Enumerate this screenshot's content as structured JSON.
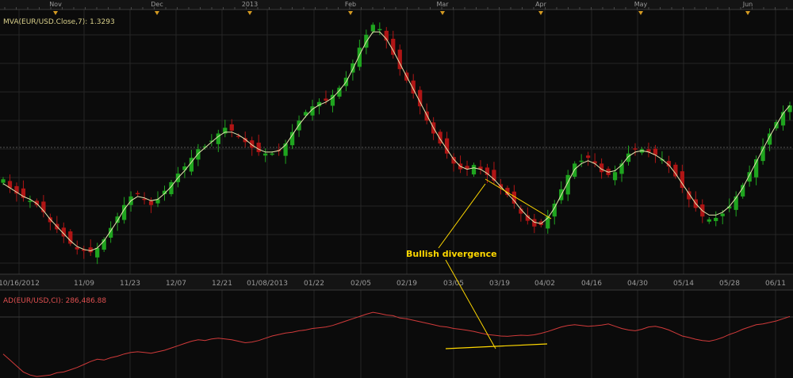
{
  "colors": {
    "background": "#0b0b0b",
    "grid": "#262626",
    "axis_text": "#9a9a9a",
    "bull": "#1fa51f",
    "bear": "#b01515",
    "mva": "#e6e6b0",
    "ad_line": "#d03a3a",
    "annotation": "#ffd800",
    "mva_label": "#d8cf8a",
    "ad_label": "#e05050",
    "event_marker": "#d49a22"
  },
  "top_axis": {
    "months": [
      "Nov",
      "Dec",
      "2013",
      "Feb",
      "Mar",
      "Apr",
      "May",
      "Jun"
    ]
  },
  "bottom_axis": {
    "labels": [
      "10/16/2012",
      "11/09",
      "11/23",
      "12/07",
      "12/21",
      "01/08/2013",
      "01/22",
      "02/05",
      "02/19",
      "03/05",
      "03/19",
      "04/02",
      "04/16",
      "04/30",
      "05/14",
      "05/28",
      "06/11"
    ]
  },
  "price_panel": {
    "indicator_label": "MVA(EUR/USD.Close,7): 1.3293"
  },
  "ad_panel": {
    "indicator_label": "AD(EUR/USD,CI): 286,486.88"
  },
  "annotation": {
    "text": "Bullish divergence"
  },
  "chart_data": [
    {
      "type": "candlestick",
      "series": [
        {
          "name": "EUR/USD",
          "close": [
            1.3035,
            1.3005,
            1.2985,
            1.297,
            1.296,
            1.2945,
            1.292,
            1.2885,
            1.286,
            1.2835,
            1.281,
            1.279,
            1.2785,
            1.278,
            1.2795,
            1.2825,
            1.2865,
            1.2905,
            1.2945,
            1.2975,
            1.2985,
            1.2965,
            1.2945,
            1.2965,
            1.2995,
            1.3025,
            1.3055,
            1.308,
            1.311,
            1.314,
            1.315,
            1.317,
            1.3195,
            1.3215,
            1.3205,
            1.3185,
            1.3165,
            1.3145,
            1.313,
            1.3125,
            1.3125,
            1.3135,
            1.316,
            1.32,
            1.324,
            1.327,
            1.329,
            1.3305,
            1.331,
            1.333,
            1.3355,
            1.339,
            1.344,
            1.3495,
            1.354,
            1.3575,
            1.356,
            1.352,
            1.347,
            1.342,
            1.338,
            1.3335,
            1.329,
            1.324,
            1.3195,
            1.316,
            1.3125,
            1.309,
            1.307,
            1.307,
            1.3085,
            1.307,
            1.305,
            1.303,
            1.3005,
            1.298,
            1.295,
            1.2915,
            1.289,
            1.287,
            1.2875,
            1.2905,
            1.295,
            1.3,
            1.305,
            1.309,
            1.31,
            1.311,
            1.309,
            1.306,
            1.305,
            1.306,
            1.309,
            1.3125,
            1.314,
            1.314,
            1.313,
            1.312,
            1.3105,
            1.308,
            1.3045,
            1.3005,
            1.2965,
            1.2935,
            1.2905,
            1.2895,
            1.29,
            1.2915,
            1.294,
            1.2975,
            1.3015,
            1.306,
            1.3105,
            1.315,
            1.3195,
            1.3235,
            1.327,
            1.3293
          ]
        },
        {
          "name": "MVA(EUR/USD.Close,7)",
          "values": [
            1.302,
            1.3005,
            1.299,
            1.2975,
            1.2965,
            1.295,
            1.2925,
            1.2895,
            1.287,
            1.2845,
            1.282,
            1.28,
            1.279,
            1.2785,
            1.2795,
            1.282,
            1.2855,
            1.289,
            1.293,
            1.296,
            1.2975,
            1.297,
            1.296,
            1.2965,
            1.2985,
            1.301,
            1.304,
            1.3065,
            1.3095,
            1.3125,
            1.3145,
            1.3165,
            1.3185,
            1.32,
            1.32,
            1.319,
            1.3175,
            1.3155,
            1.314,
            1.313,
            1.313,
            1.3135,
            1.3155,
            1.319,
            1.3225,
            1.3255,
            1.328,
            1.3295,
            1.3305,
            1.332,
            1.3345,
            1.3375,
            1.342,
            1.347,
            1.3515,
            1.355,
            1.355,
            1.3525,
            1.3485,
            1.344,
            1.3395,
            1.335,
            1.3305,
            1.326,
            1.3215,
            1.3175,
            1.314,
            1.3105,
            1.308,
            1.307,
            1.3075,
            1.307,
            1.3055,
            1.3035,
            1.301,
            1.2985,
            1.296,
            1.293,
            1.2905,
            1.2885,
            1.288,
            1.29,
            1.2935,
            1.298,
            1.3025,
            1.307,
            1.309,
            1.31,
            1.309,
            1.307,
            1.306,
            1.3065,
            1.3085,
            1.3115,
            1.313,
            1.3135,
            1.313,
            1.312,
            1.3105,
            1.3085,
            1.3055,
            1.302,
            1.2985,
            1.295,
            1.2925,
            1.291,
            1.291,
            1.292,
            1.294,
            1.297,
            1.3005,
            1.305,
            1.3095,
            1.314,
            1.3185,
            1.3225,
            1.3265,
            1.3293
          ]
        }
      ],
      "ylim": [
        1.272,
        1.362
      ]
    },
    {
      "type": "line",
      "series": [
        {
          "name": "AD(EUR/USD,CI)",
          "values": [
            160,
            120,
            80,
            40,
            20,
            10,
            15,
            20,
            35,
            40,
            55,
            70,
            90,
            110,
            125,
            120,
            135,
            145,
            160,
            170,
            175,
            170,
            165,
            175,
            185,
            200,
            215,
            230,
            245,
            255,
            250,
            260,
            265,
            260,
            255,
            245,
            235,
            240,
            250,
            265,
            280,
            290,
            300,
            305,
            315,
            320,
            330,
            335,
            340,
            350,
            365,
            380,
            395,
            410,
            425,
            438,
            430,
            420,
            415,
            400,
            395,
            385,
            375,
            365,
            355,
            345,
            340,
            330,
            325,
            318,
            310,
            300,
            290,
            285,
            280,
            278,
            282,
            285,
            283,
            288,
            298,
            310,
            325,
            340,
            350,
            355,
            350,
            345,
            348,
            352,
            360,
            345,
            330,
            320,
            315,
            325,
            340,
            345,
            335,
            320,
            300,
            280,
            270,
            258,
            250,
            245,
            255,
            270,
            290,
            305,
            325,
            340,
            355,
            360,
            370,
            380,
            395,
            410
          ]
        }
      ],
      "ylim": [
        0,
        470
      ]
    }
  ]
}
